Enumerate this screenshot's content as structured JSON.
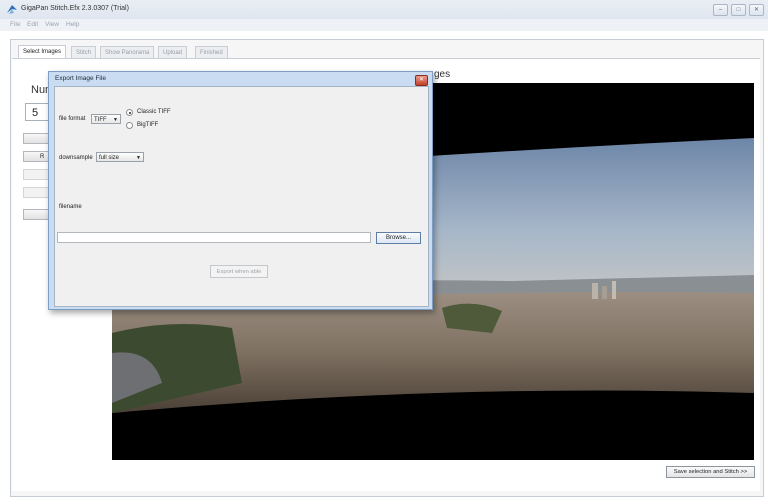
{
  "window": {
    "title": "GigaPan Stitch.Efx 2.3.0307 (Trial)",
    "controls": [
      "–",
      "□",
      "✕"
    ]
  },
  "menu": [
    "File",
    "Edit",
    "View",
    "Help"
  ],
  "tabs": [
    {
      "label": "Select Images",
      "active": true
    },
    {
      "label": "Stitch",
      "active": false
    },
    {
      "label": "Show Panorama",
      "active": false
    },
    {
      "label": "Upload",
      "active": false
    },
    {
      "label": "Finished",
      "active": false
    }
  ],
  "left_panel": {
    "num_label": "Num",
    "num_value": "5",
    "button_fragment": "R"
  },
  "panorama": {
    "title_fragment": "ges"
  },
  "stitch_button": "Save selection and Stitch >>",
  "dialog": {
    "title": "Export Image File",
    "close": "✕",
    "file_format_label": "file format",
    "file_format_value": "TIFF",
    "format_options": [
      {
        "label": "Classic TIFF",
        "checked": true
      },
      {
        "label": "BigTIFF",
        "checked": false
      }
    ],
    "downsample_label": "downsample",
    "downsample_value": "full size",
    "filename_label": "filename",
    "filename_value": "",
    "browse_label": "Browse...",
    "export_label": "Export when able"
  },
  "icons": {
    "app": "gigapan-logo-icon",
    "dropdown": "chevron-down-icon"
  }
}
